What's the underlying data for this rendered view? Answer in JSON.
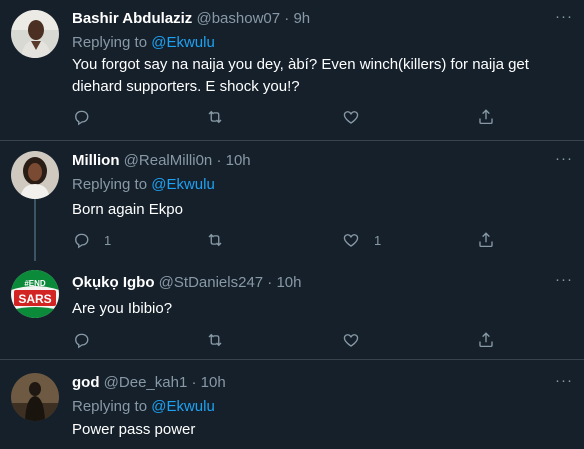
{
  "tweets": [
    {
      "name": "Bashir Abdulaziz",
      "handle": "@bashow07",
      "dot": "·",
      "time": "9h",
      "replying_prefix": "Replying to ",
      "replying_to": "@Ekwulu",
      "text": "You forgot say na naija you dey, àbí? Even winch(killers) for naija get diehard supporters. E shock you!?",
      "reply_count": "",
      "retweet_count": "",
      "like_count": ""
    },
    {
      "name": "Million",
      "handle": "@RealMilli0n",
      "dot": "·",
      "time": "10h",
      "replying_prefix": "Replying to ",
      "replying_to": "@Ekwulu",
      "text": "Born again Ekpo",
      "reply_count": "1",
      "retweet_count": "",
      "like_count": "1"
    },
    {
      "name": "Ọkụkọ Igbo",
      "handle": "@StDaniels247",
      "dot": "·",
      "time": "10h",
      "text": "Are you Ibibio?",
      "avatar_text": "SARS",
      "avatar_text_top": "#END",
      "reply_count": "",
      "retweet_count": "",
      "like_count": ""
    },
    {
      "name": "god",
      "handle": "@Dee_kah1",
      "dot": "·",
      "time": "10h",
      "replying_prefix": "Replying to ",
      "replying_to": "@Ekwulu",
      "text": "Power pass power"
    }
  ],
  "icons": {
    "more": "more-icon",
    "reply": "reply-icon",
    "retweet": "retweet-icon",
    "like": "like-icon",
    "share": "share-icon"
  },
  "colors": {
    "background": "#15202b",
    "secondary_text": "#8899a6",
    "link": "#1da1f2",
    "separator": "#38444d"
  }
}
